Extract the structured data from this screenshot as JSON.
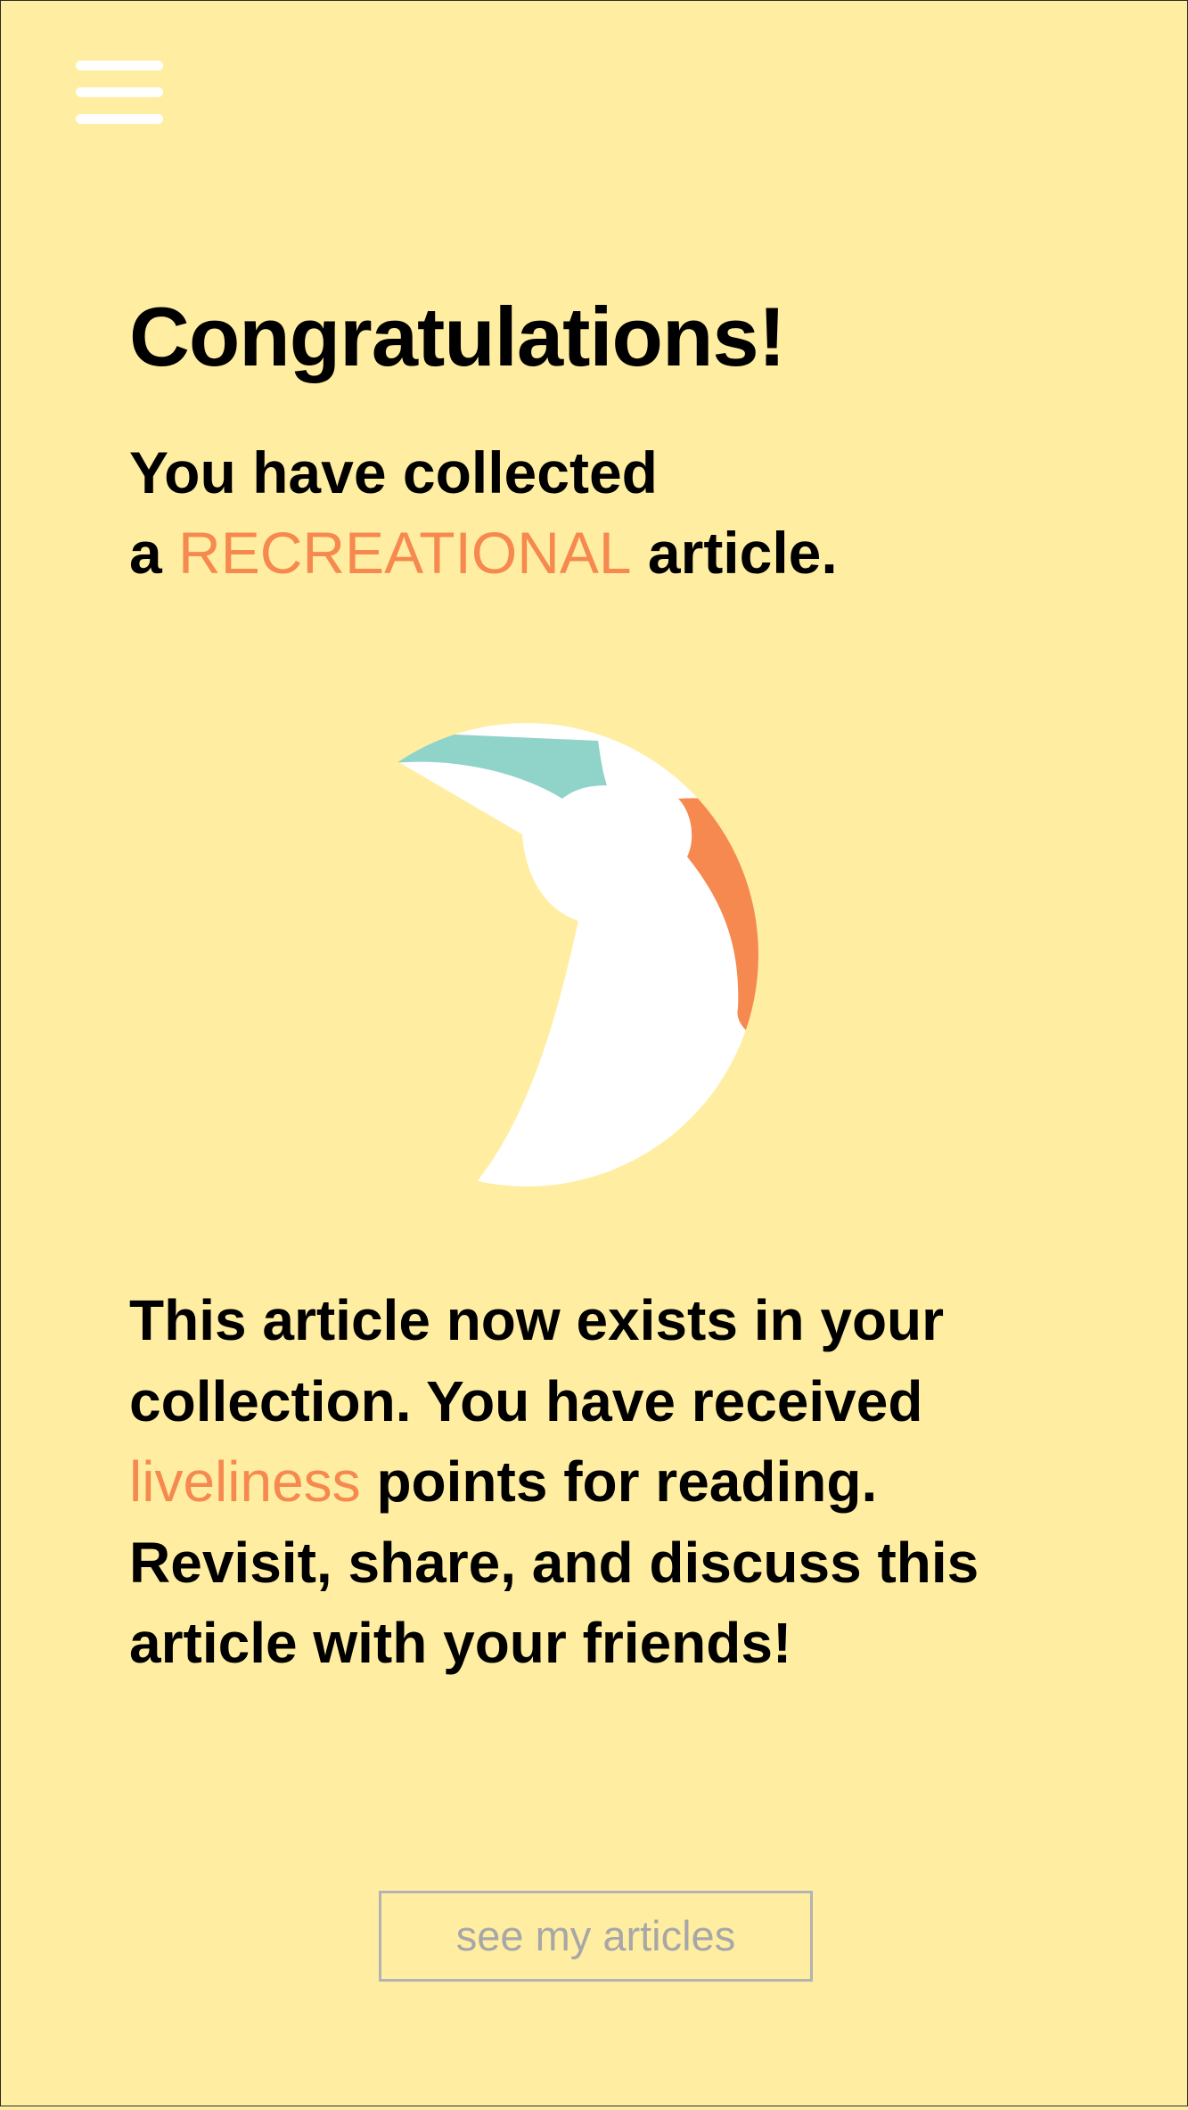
{
  "header": {
    "menu_icon": "hamburger-menu-icon",
    "menu_icon_color": "#ffffff"
  },
  "main": {
    "title": "Congratulations!",
    "subtitle": {
      "line1": "You have collected",
      "line2_prefix": "a ",
      "category": "RECREATIONAL",
      "line2_suffix": " article."
    },
    "illustration": {
      "icon": "beach-ball-icon",
      "colors": {
        "panel_white": "#ffffff",
        "panel_teal": "#8fd3c9",
        "panel_orange": "#f6894f"
      }
    },
    "message": {
      "line1": "This article now exists in your",
      "line2": "collection. You have received",
      "line3_highlight": "liveliness",
      "line3_suffix": " points for reading.",
      "line4": "Revisit, share, and discuss this",
      "line5": "article with your friends!"
    },
    "cta_label": "see my articles"
  },
  "colors": {
    "background": "#ffeea1",
    "accent": "#f6894f",
    "text": "#000000",
    "button_border": "#b3b3b3",
    "button_text": "#a7a7a7"
  }
}
